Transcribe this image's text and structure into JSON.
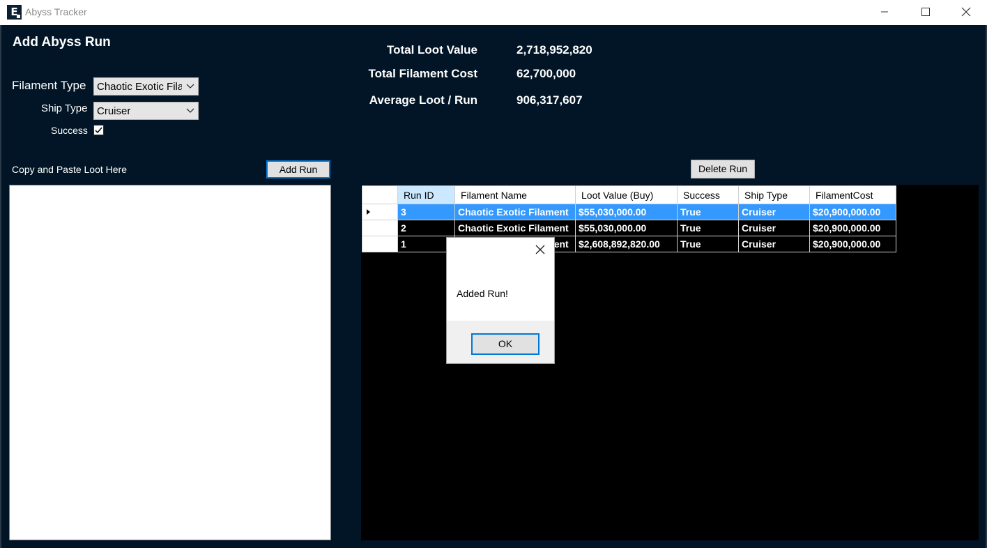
{
  "window": {
    "title": "Abyss Tracker",
    "icon_letter": "E"
  },
  "form": {
    "heading": "Add Abyss Run",
    "filament_label": "Filament Type",
    "filament_value": "Chaotic Exotic Filament",
    "ship_label": "Ship Type",
    "ship_value": "Cruiser",
    "success_label": "Success",
    "success_checked": true,
    "paste_label": "Copy and Paste Loot Here",
    "add_button": "Add Run",
    "paste_value": ""
  },
  "stats": {
    "total_loot_label": "Total Loot Value",
    "total_loot_value": "2,718,952,820",
    "total_filament_label": "Total Filament Cost",
    "total_filament_value": "62,700,000",
    "average_label": "Average Loot / Run",
    "average_value": "906,317,607"
  },
  "grid": {
    "delete_button": "Delete Run",
    "columns": [
      "Run ID",
      "Filament Name",
      "Loot Value (Buy)",
      "Success",
      "Ship Type",
      "FilamentCost"
    ],
    "rows": [
      [
        "3",
        "Chaotic Exotic Filament",
        "$55,030,000.00",
        "True",
        "Cruiser",
        "$20,900,000.00"
      ],
      [
        "2",
        "Chaotic Exotic Filament",
        "$55,030,000.00",
        "True",
        "Cruiser",
        "$20,900,000.00"
      ],
      [
        "1",
        "Chaotic Exotic Filament",
        "$2,608,892,820.00",
        "True",
        "Cruiser",
        "$20,900,000.00"
      ]
    ]
  },
  "dialog": {
    "message": "Added Run!",
    "ok_button": "OK"
  },
  "colors": {
    "background": "#011526",
    "selection": "#3399ff",
    "focus": "#0078d7"
  }
}
